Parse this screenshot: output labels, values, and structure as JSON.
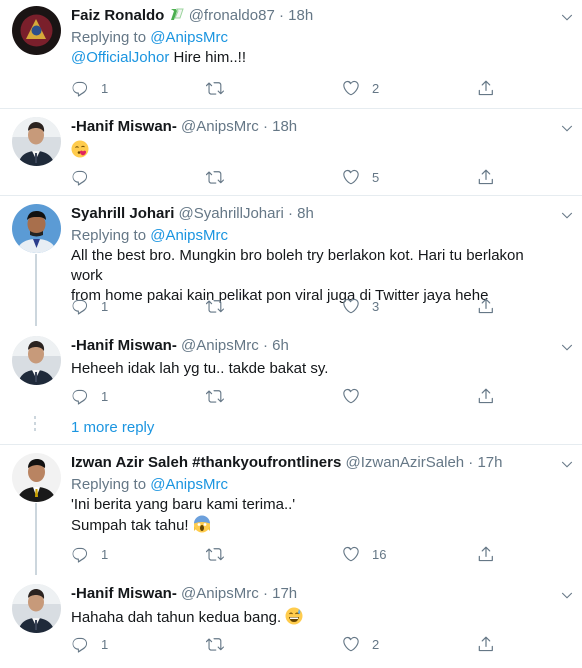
{
  "tweets": [
    {
      "name": "Faiz Ronaldo",
      "handle": "@fronaldo87",
      "time": "18h",
      "replying_label": "Replying to",
      "replying_to": "@AnipsMrc",
      "mention": "@OfficialJohor",
      "text": " Hire him..!!",
      "reply_count": "1",
      "retweet_count": "",
      "like_count": "2"
    },
    {
      "name": "-Hanif Miswan-",
      "handle": "@AnipsMrc",
      "time": "18h",
      "emoji": "face-blowing-kiss",
      "reply_count": "",
      "retweet_count": "",
      "like_count": "5"
    },
    {
      "name": "Syahrill Johari",
      "handle": "@SyahrillJohari",
      "time": "8h",
      "replying_label": "Replying to",
      "replying_to": "@AnipsMrc",
      "text_line1": "All the best bro. Mungkin bro boleh try berlakon kot. Hari tu berlakon work",
      "text_line2": "from home pakai kain pelikat pon viral juga di Twitter jaya hehe",
      "reply_count": "1",
      "retweet_count": "",
      "like_count": "3"
    },
    {
      "name": "-Hanif Miswan-",
      "handle": "@AnipsMrc",
      "time": "6h",
      "text": "Heheeh idak lah yg tu.. takde bakat sy.",
      "reply_count": "1",
      "retweet_count": "",
      "like_count": ""
    },
    {
      "name": "Izwan Azir Saleh #thankyoufrontliners",
      "handle": "@IzwanAzirSaleh",
      "time": "17h",
      "replying_label": "Replying to",
      "replying_to": "@AnipsMrc",
      "text_line1": "'Ini berita yang baru kami terima..'",
      "text_line2": "Sumpah tak tahu!",
      "emoji": "face-screaming-in-fear",
      "reply_count": "1",
      "retweet_count": "",
      "like_count": "16"
    },
    {
      "name": "-Hanif Miswan-",
      "handle": "@AnipsMrc",
      "time": "17h",
      "text": "Hahaha dah tahun kedua bang.",
      "emoji": "grinning-face-with-sweat",
      "reply_count": "1",
      "retweet_count": "",
      "like_count": "2"
    }
  ],
  "more_replies": "1 more reply",
  "dot_separator": "·",
  "colors": {
    "link": "#1b95e0",
    "secondary": "#657786",
    "border": "#e6ecf0",
    "thread": "#ccd6dd"
  },
  "icons": [
    "reply-icon",
    "retweet-icon",
    "like-icon",
    "share-icon",
    "caret-down-icon",
    "verified-badge-icon"
  ]
}
